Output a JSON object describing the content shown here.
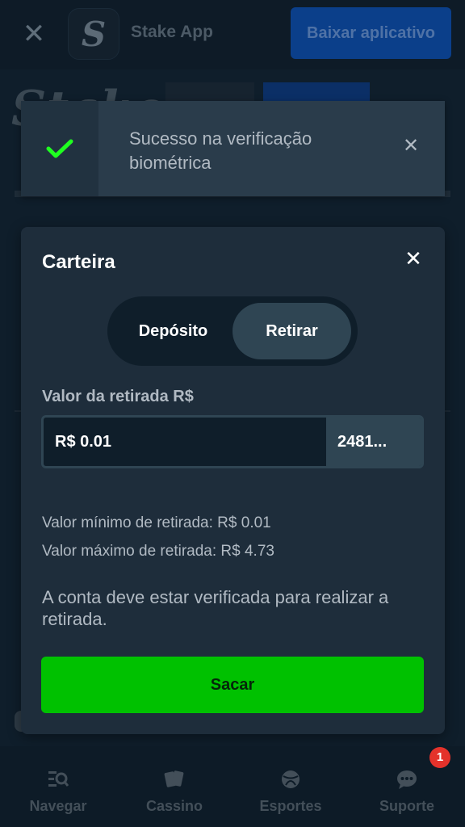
{
  "banner": {
    "app_name": "Stake App",
    "download_label": "Baixar aplicativo",
    "close_icon": "close-icon",
    "app_icon": "stake-logo-icon"
  },
  "toast": {
    "message": "Sucesso na verificação biométrica",
    "icon": "check-icon",
    "status_color": "#1fff20"
  },
  "wallet": {
    "title": "Carteira",
    "tabs": [
      {
        "label": "Depósito",
        "active": false
      },
      {
        "label": "Retirar",
        "active": true
      }
    ],
    "amount_label": "Valor da retirada R$",
    "amount_value": "R$ 0.01",
    "amount_secondary": "2481...",
    "min_text": "Valor mínimo de retirada: R$ 0.01",
    "max_text": "Valor máximo de retirada: R$ 4.73",
    "notice": "A conta deve estar verificada para realizar a retirada.",
    "submit_label": "Sacar",
    "accent_color": "#00c100"
  },
  "bottom_nav": {
    "items": [
      {
        "label": "Navegar",
        "icon": "browse-icon"
      },
      {
        "label": "Cassino",
        "icon": "cards-icon"
      },
      {
        "label": "Esportes",
        "icon": "ball-icon"
      },
      {
        "label": "Suporte",
        "icon": "chat-icon"
      }
    ],
    "badge_count": "1"
  }
}
